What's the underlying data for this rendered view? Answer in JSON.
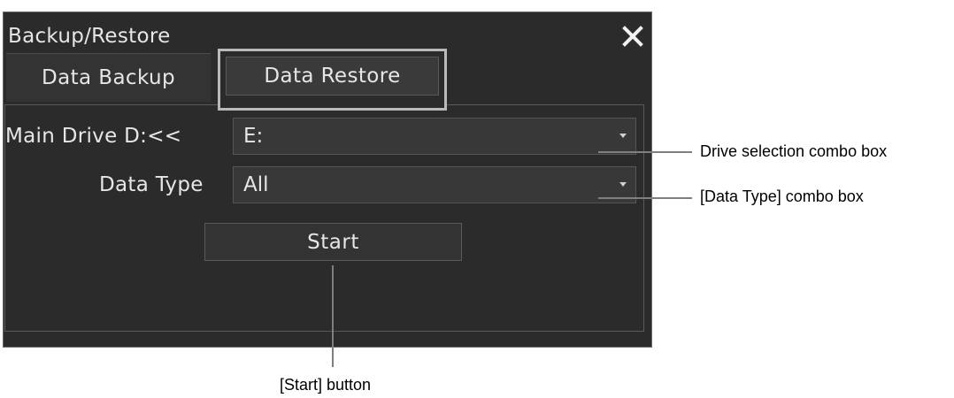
{
  "window": {
    "title": "Backup/Restore"
  },
  "tabs": [
    {
      "label": "Data Backup",
      "selected": false
    },
    {
      "label": "Data Restore",
      "selected": true
    }
  ],
  "form": {
    "drive_label": "Main Drive D:<<",
    "drive_value": "E:",
    "type_label": "Data Type",
    "type_value": "All",
    "start_label": "Start"
  },
  "annotations": {
    "drive": "Drive selection combo box",
    "type": "[Data Type] combo box",
    "start": "[Start] button"
  },
  "colors": {
    "window_bg": "#2b2b2b",
    "text": "#e6e6e6",
    "highlight_border": "#b9b9b9",
    "callout_line": "#7f7f7f"
  },
  "icons": {
    "close": "close-icon",
    "combo_arrow": "chevron-down-icon"
  }
}
